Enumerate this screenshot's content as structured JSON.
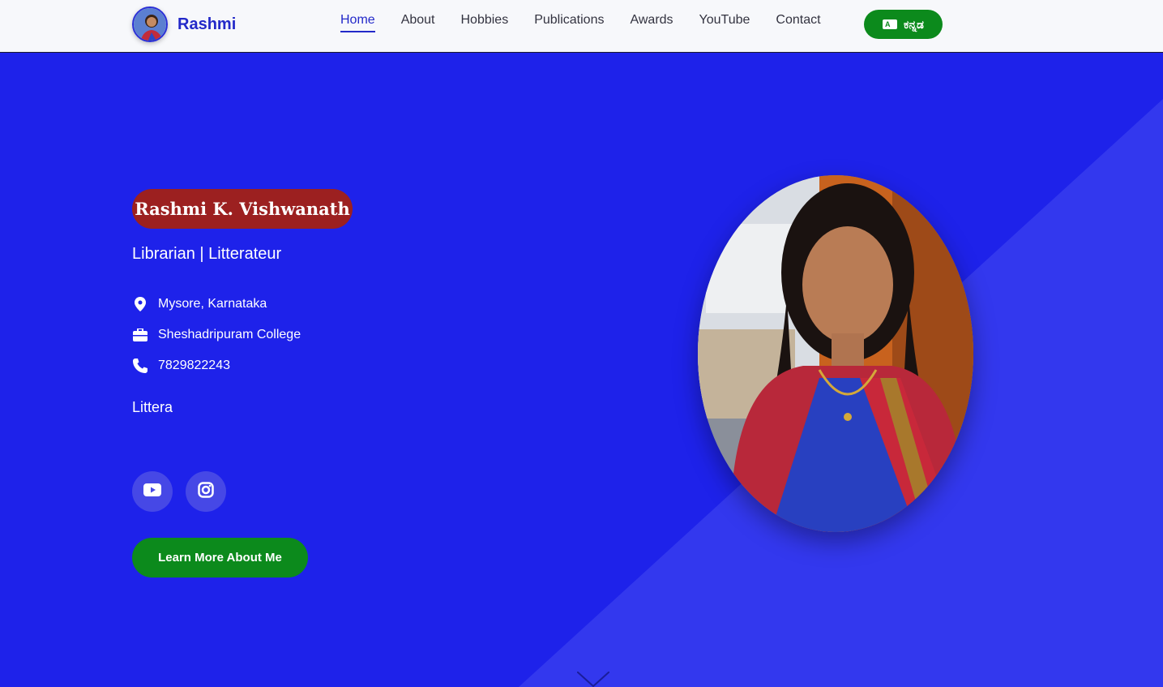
{
  "brand": {
    "name": "Rashmi",
    "avatar_icon": "profile-avatar"
  },
  "nav": {
    "items": [
      {
        "label": "Home",
        "active": true
      },
      {
        "label": "About"
      },
      {
        "label": "Hobbies"
      },
      {
        "label": "Publications"
      },
      {
        "label": "Awards"
      },
      {
        "label": "YouTube"
      },
      {
        "label": "Contact"
      }
    ],
    "language_button": {
      "label": "ಕನ್ನಡ",
      "icon": "language-icon"
    }
  },
  "hero": {
    "name": "Rashmi K. Vishwanath",
    "subtitle": "Librarian | Litterateur",
    "info": [
      {
        "icon": "location-pin-icon",
        "text": "Mysore, Karnataka"
      },
      {
        "icon": "briefcase-icon",
        "text": "Sheshadripuram College"
      },
      {
        "icon": "phone-icon",
        "text": "7829822243"
      }
    ],
    "tagline": "Littera",
    "socials": [
      {
        "icon": "youtube-icon"
      },
      {
        "icon": "instagram-icon"
      }
    ],
    "cta_label": "Learn More About Me",
    "portrait_icon": "profile-photo"
  },
  "colors": {
    "hero_bg": "#1e22ea",
    "accent_green": "#0c8a1c",
    "name_pill": "#9c2020",
    "brand_blue": "#2329c9"
  }
}
